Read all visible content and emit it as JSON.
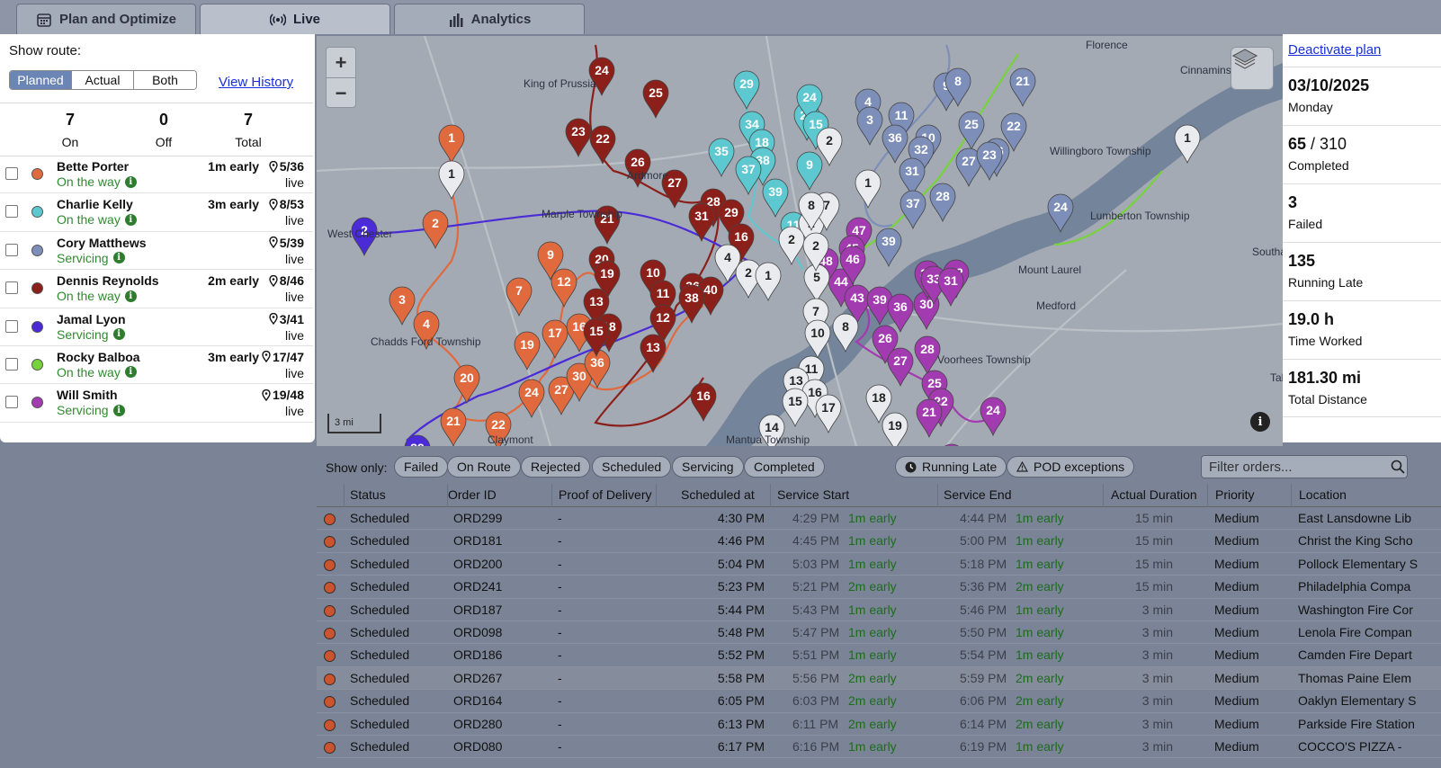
{
  "tabs": [
    {
      "label": "Plan and Optimize",
      "icon": "calendar-icon"
    },
    {
      "label": "Live",
      "icon": "broadcast-icon"
    },
    {
      "label": "Analytics",
      "icon": "bar-chart-icon"
    }
  ],
  "left_panel": {
    "show_route_label": "Show route:",
    "route_options": [
      "Planned",
      "Actual",
      "Both"
    ],
    "selected_route": "Planned",
    "view_history": "View History",
    "counts": [
      {
        "value": "7",
        "label": "On"
      },
      {
        "value": "0",
        "label": "Off"
      },
      {
        "value": "7",
        "label": "Total"
      }
    ],
    "drivers": [
      {
        "name": "Bette Porter",
        "state": "On the way",
        "early": "1m early",
        "stops": "5/36",
        "live": "live",
        "color": "#e06a3d"
      },
      {
        "name": "Charlie Kelly",
        "state": "On the way",
        "early": "3m early",
        "stops": "8/53",
        "live": "live",
        "color": "#5ec8d0"
      },
      {
        "name": "Cory Matthews",
        "state": "Servicing",
        "early": "",
        "stops": "5/39",
        "live": "live",
        "color": "#7d8fb8"
      },
      {
        "name": "Dennis Reynolds",
        "state": "On the way",
        "early": "2m early",
        "stops": "8/46",
        "live": "live",
        "color": "#8b1f1a"
      },
      {
        "name": "Jamal Lyon",
        "state": "Servicing",
        "early": "",
        "stops": "3/41",
        "live": "live",
        "color": "#4a2bd6"
      },
      {
        "name": "Rocky Balboa",
        "state": "On the way",
        "early": "3m early",
        "stops": "17/47",
        "live": "live",
        "color": "#76d43a"
      },
      {
        "name": "Will Smith",
        "state": "Servicing",
        "early": "",
        "stops": "19/48",
        "live": "live",
        "color": "#a23bb0"
      }
    ]
  },
  "map": {
    "places": [
      "Cinnaminson",
      "King of Prussia",
      "Willingboro Township",
      "Florence",
      "Lumberton Township",
      "Southampton Township",
      "Mount Laurel",
      "Medford",
      "Voorhees Township",
      "Tabernacle Township",
      "Marple Township",
      "Chadds Ford Township",
      "West Chester",
      "Claymont",
      "Mantua Township",
      "Ardmore"
    ],
    "scale_label": "3 mi",
    "zoom_in": "+",
    "zoom_out": "−"
  },
  "stats": {
    "deactivate": "Deactivate plan",
    "date": "03/10/2025",
    "weekday": "Monday",
    "completed_done": "65",
    "completed_total": " / 310",
    "completed_label": "Completed",
    "failed": "3",
    "failed_label": "Failed",
    "late": "135",
    "late_label": "Running Late",
    "time": "19.0 h",
    "time_label": "Time Worked",
    "distance": "181.30 mi",
    "distance_label": "Total Distance"
  },
  "filters": {
    "show_only": "Show only:",
    "chips": [
      "Failed",
      "On Route",
      "Rejected",
      "Scheduled",
      "Servicing",
      "Completed"
    ],
    "running_late": "Running Late",
    "pod_exceptions": "POD exceptions",
    "search_placeholder": "Filter orders..."
  },
  "table": {
    "columns": [
      "Status",
      "Order ID",
      "Proof of Delivery",
      "Scheduled at",
      "Service Start",
      "Service End",
      "Actual Duration",
      "Priority",
      "Location"
    ],
    "rows": [
      {
        "status": "Scheduled",
        "id": "ORD299",
        "pod": "-",
        "sched": "4:30 PM",
        "start": "4:29 PM",
        "start_early": "1m early",
        "end": "4:44 PM",
        "end_early": "1m early",
        "duration": "15 min",
        "priority": "Medium",
        "location": "East Lansdowne Lib"
      },
      {
        "status": "Scheduled",
        "id": "ORD181",
        "pod": "-",
        "sched": "4:46 PM",
        "start": "4:45 PM",
        "start_early": "1m early",
        "end": "5:00 PM",
        "end_early": "1m early",
        "duration": "15 min",
        "priority": "Medium",
        "location": "Christ the King Scho"
      },
      {
        "status": "Scheduled",
        "id": "ORD200",
        "pod": "-",
        "sched": "5:04 PM",
        "start": "5:03 PM",
        "start_early": "1m early",
        "end": "5:18 PM",
        "end_early": "1m early",
        "duration": "15 min",
        "priority": "Medium",
        "location": "Pollock Elementary S"
      },
      {
        "status": "Scheduled",
        "id": "ORD241",
        "pod": "-",
        "sched": "5:23 PM",
        "start": "5:21 PM",
        "start_early": "2m early",
        "end": "5:36 PM",
        "end_early": "2m early",
        "duration": "15 min",
        "priority": "Medium",
        "location": "Philadelphia Compa"
      },
      {
        "status": "Scheduled",
        "id": "ORD187",
        "pod": "-",
        "sched": "5:44 PM",
        "start": "5:43 PM",
        "start_early": "1m early",
        "end": "5:46 PM",
        "end_early": "1m early",
        "duration": "3 min",
        "priority": "Medium",
        "location": "Washington Fire Cor"
      },
      {
        "status": "Scheduled",
        "id": "ORD098",
        "pod": "-",
        "sched": "5:48 PM",
        "start": "5:47 PM",
        "start_early": "1m early",
        "end": "5:50 PM",
        "end_early": "1m early",
        "duration": "3 min",
        "priority": "Medium",
        "location": "Lenola Fire Compan"
      },
      {
        "status": "Scheduled",
        "id": "ORD186",
        "pod": "-",
        "sched": "5:52 PM",
        "start": "5:51 PM",
        "start_early": "1m early",
        "end": "5:54 PM",
        "end_early": "1m early",
        "duration": "3 min",
        "priority": "Medium",
        "location": "Camden Fire Depart"
      },
      {
        "status": "Scheduled",
        "id": "ORD267",
        "pod": "-",
        "sched": "5:58 PM",
        "start": "5:56 PM",
        "start_early": "2m early",
        "end": "5:59 PM",
        "end_early": "2m early",
        "duration": "3 min",
        "priority": "Medium",
        "location": "Thomas Paine Elem"
      },
      {
        "status": "Scheduled",
        "id": "ORD164",
        "pod": "-",
        "sched": "6:05 PM",
        "start": "6:03 PM",
        "start_early": "2m early",
        "end": "6:06 PM",
        "end_early": "2m early",
        "duration": "3 min",
        "priority": "Medium",
        "location": "Oaklyn Elementary S"
      },
      {
        "status": "Scheduled",
        "id": "ORD280",
        "pod": "-",
        "sched": "6:13 PM",
        "start": "6:11 PM",
        "start_early": "2m early",
        "end": "6:14 PM",
        "end_early": "2m early",
        "duration": "3 min",
        "priority": "Medium",
        "location": "Parkside Fire Station"
      },
      {
        "status": "Scheduled",
        "id": "ORD080",
        "pod": "-",
        "sched": "6:17 PM",
        "start": "6:16 PM",
        "start_early": "1m early",
        "end": "6:19 PM",
        "end_early": "1m early",
        "duration": "3 min",
        "priority": "Medium",
        "location": "COCCO'S PIZZA -"
      }
    ]
  }
}
